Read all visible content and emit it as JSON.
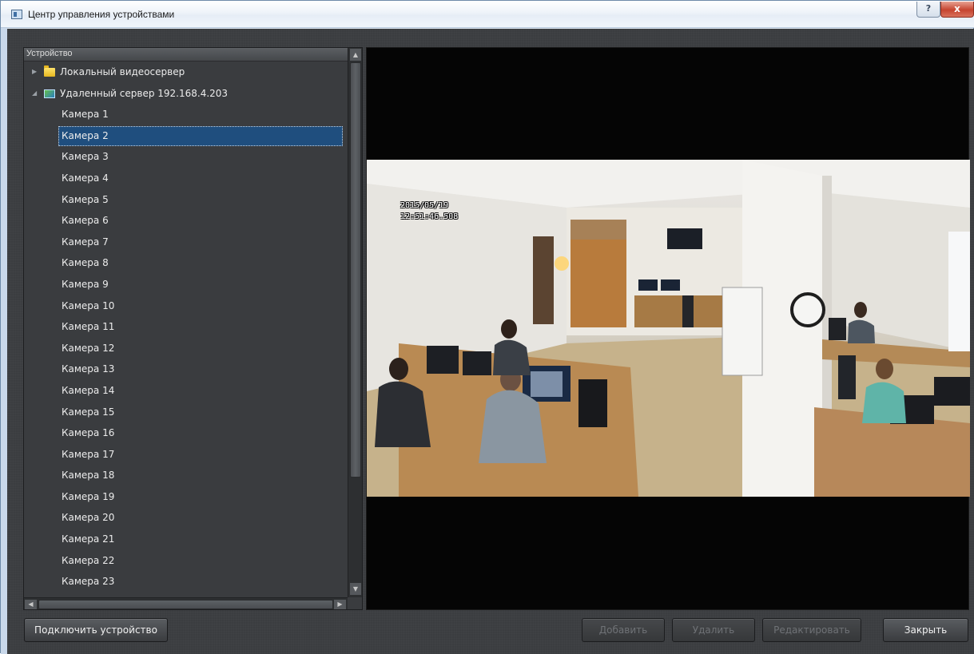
{
  "window": {
    "title": "Центр управления устройствами",
    "help_label": "?",
    "close_label": "x"
  },
  "tree": {
    "header": "Устройство",
    "nodes": [
      {
        "label": "Локальный видеосервер",
        "icon": "folder-icon",
        "expanded": false
      },
      {
        "label": "Удаленный сервер 192.168.4.203",
        "icon": "server-icon",
        "expanded": true
      }
    ],
    "cameras": [
      "Камера 1",
      "Камера 2",
      "Камера 3",
      "Камера 4",
      "Камера 5",
      "Камера 6",
      "Камера 7",
      "Камера 8",
      "Камера 9",
      "Камера 10",
      "Камера 11",
      "Камера 12",
      "Камера 13",
      "Камера 14",
      "Камера 15",
      "Камера 16",
      "Камера 17",
      "Камера 18",
      "Камера 19",
      "Камера 20",
      "Камера 21",
      "Камера 22",
      "Камера 23"
    ],
    "selected_camera": "Камера 2"
  },
  "video": {
    "date": "2015/05/19",
    "time": "12:51:46.508"
  },
  "buttons": {
    "connect": "Подключить устройство",
    "add": "Добавить",
    "delete": "Удалить",
    "edit": "Редактировать",
    "close": "Закрыть"
  },
  "colors": {
    "selection": "#1f4e7e",
    "panel_bg": "#3b3d40",
    "video_bg": "#050505"
  }
}
